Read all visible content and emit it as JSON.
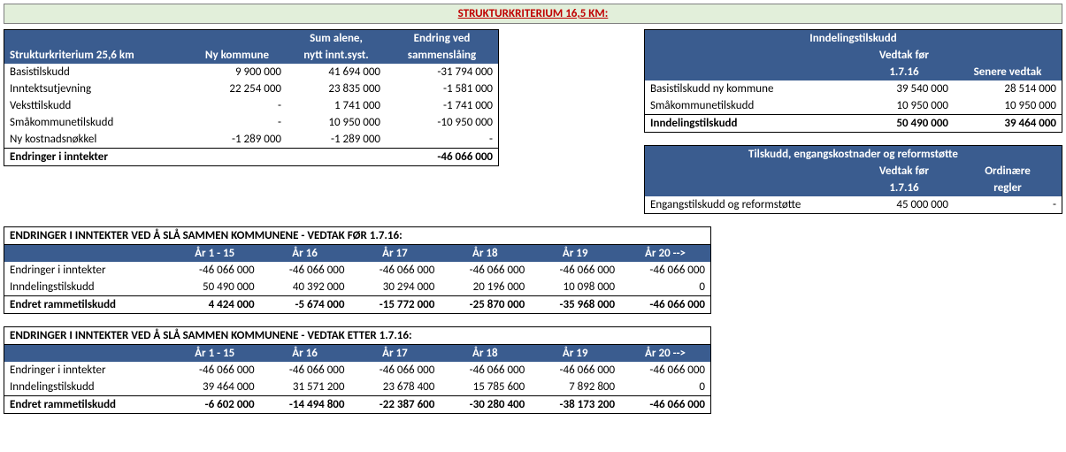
{
  "title": "STRUKTURKRITERIUM 16,5 KM:",
  "table1": {
    "headers": {
      "c1": "Strukturkriterium 25,6 km",
      "c2": "Ny kommune",
      "c3_line1": "Sum alene,",
      "c3_line2": "nytt innt.syst.",
      "c4_line1": "Endring ved",
      "c4_line2": "sammenslåing"
    },
    "rows": [
      {
        "label": "Basistilskudd",
        "c2": "9 900 000",
        "c3": "41 694 000",
        "c4": "-31 794 000"
      },
      {
        "label": "Inntektsutjevning",
        "c2": "22 254 000",
        "c3": "23 835 000",
        "c4": "-1 581 000"
      },
      {
        "label": "Veksttilskudd",
        "c2": "-",
        "c3": "1 741 000",
        "c4": "-1 741 000"
      },
      {
        "label": "Småkommunetilskudd",
        "c2": "-",
        "c3": "10 950 000",
        "c4": "-10 950 000"
      },
      {
        "label": "Ny kostnadsnøkkel",
        "c2": "-1 289 000",
        "c3": "-1 289 000",
        "c4": "-"
      }
    ],
    "total": {
      "label": "Endringer i inntekter",
      "c2": "",
      "c3": "",
      "c4": "-46 066 000"
    }
  },
  "right1": {
    "title": "Inndelingstilskudd",
    "h2_line1": "Vedtak før",
    "h2_line2": "1.7.16",
    "h3": "Senere vedtak",
    "rows": [
      {
        "label": "Basistilskudd ny kommune",
        "c2": "39 540 000",
        "c3": "28 514 000"
      },
      {
        "label": "Småkommunetilskudd",
        "c2": "10 950 000",
        "c3": "10 950 000"
      }
    ],
    "total": {
      "label": "Inndelingstilskudd",
      "c2": "50 490 000",
      "c3": "39 464 000"
    }
  },
  "right2": {
    "title": "Tilskudd, engangskostnader og reformstøtte",
    "h2_line1": "Vedtak før",
    "h2_line2": "1.7.16",
    "h3_line1": "Ordinære",
    "h3_line2": "regler",
    "row": {
      "label": "Engangstilskudd og reformstøtte",
      "c2": "45 000 000",
      "c3": "-"
    }
  },
  "years": {
    "y1": "År 1 - 15",
    "y2": "År 16",
    "y3": "År 17",
    "y4": "År 18",
    "y5": "År 19",
    "y6": "År 20 -->"
  },
  "section_before": {
    "title": "ENDRINGER I INNTEKTER VED Å SLÅ SAMMEN KOMMUNENE - VEDTAK FØR 1.7.16:",
    "rows": [
      {
        "label": "Endringer i inntekter",
        "v": [
          "-46 066 000",
          "-46 066 000",
          "-46 066 000",
          "-46 066 000",
          "-46 066 000",
          "-46 066 000"
        ]
      },
      {
        "label": "Inndelingstilskudd",
        "v": [
          "50 490 000",
          "40 392 000",
          "30 294 000",
          "20 196 000",
          "10 098 000",
          "0"
        ]
      }
    ],
    "total": {
      "label": "Endret rammetilskudd",
      "v": [
        "4 424 000",
        "-5 674 000",
        "-15 772 000",
        "-25 870 000",
        "-35 968 000",
        "-46 066 000"
      ]
    }
  },
  "section_after": {
    "title": "ENDRINGER I INNTEKTER VED Å SLÅ SAMMEN KOMMUNENE - VEDTAK ETTER 1.7.16:",
    "rows": [
      {
        "label": "Endringer i inntekter",
        "v": [
          "-46 066 000",
          "-46 066 000",
          "-46 066 000",
          "-46 066 000",
          "-46 066 000",
          "-46 066 000"
        ]
      },
      {
        "label": "Inndelingstilskudd",
        "v": [
          "39 464 000",
          "31 571 200",
          "23 678 400",
          "15 785 600",
          "7 892 800",
          "0"
        ]
      }
    ],
    "total": {
      "label": "Endret rammetilskudd",
      "v": [
        "-6 602 000",
        "-14 494 800",
        "-22 387 600",
        "-30 280 400",
        "-38 173 200",
        "-46 066 000"
      ]
    }
  }
}
